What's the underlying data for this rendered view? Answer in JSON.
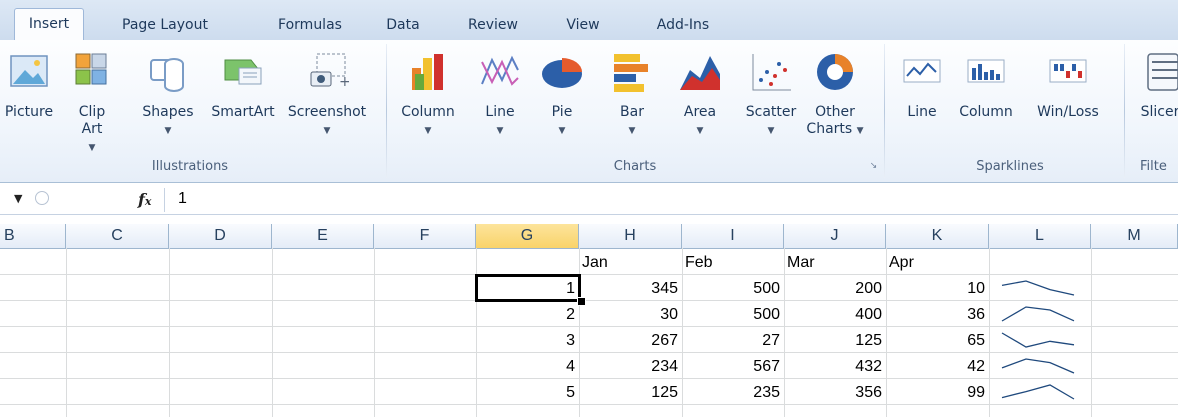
{
  "tabs": [
    "Insert",
    "Page Layout",
    "Formulas",
    "Data",
    "Review",
    "View",
    "Add-Ins"
  ],
  "active_tab": "Insert",
  "ribbon": {
    "illustrations": {
      "label": "Illustrations",
      "buttons": [
        {
          "label": "Picture",
          "icon": "picture-icon"
        },
        {
          "label": "Clip\nArt",
          "icon": "clip-art-icon"
        },
        {
          "label": "Shapes",
          "icon": "shapes-icon"
        },
        {
          "label": "SmartArt",
          "icon": "smartart-icon"
        },
        {
          "label": "Screenshot",
          "icon": "screenshot-icon"
        }
      ]
    },
    "charts": {
      "label": "Charts",
      "buttons": [
        {
          "label": "Column",
          "icon": "column-chart-icon"
        },
        {
          "label": "Line",
          "icon": "line-chart-icon"
        },
        {
          "label": "Pie",
          "icon": "pie-chart-icon"
        },
        {
          "label": "Bar",
          "icon": "bar-chart-icon"
        },
        {
          "label": "Area",
          "icon": "area-chart-icon"
        },
        {
          "label": "Scatter",
          "icon": "scatter-chart-icon"
        },
        {
          "label": "Other\nCharts",
          "icon": "other-charts-icon"
        }
      ]
    },
    "sparklines": {
      "label": "Sparklines",
      "buttons": [
        {
          "label": "Line",
          "icon": "sparkline-line-icon"
        },
        {
          "label": "Column",
          "icon": "sparkline-column-icon"
        },
        {
          "label": "Win/Loss",
          "icon": "sparkline-winloss-icon"
        }
      ]
    },
    "filter": {
      "label": "Filte",
      "buttons": [
        {
          "label": "Slicer",
          "icon": "slicer-icon"
        }
      ]
    }
  },
  "formula_bar": {
    "fx": "fx",
    "value": "1"
  },
  "columns": [
    "B",
    "C",
    "D",
    "E",
    "F",
    "G",
    "H",
    "I",
    "J",
    "K",
    "L",
    "M"
  ],
  "selected_column": "G",
  "sheet": {
    "header_row": [
      "Jan",
      "Feb",
      "Mar",
      "Apr"
    ],
    "rows": [
      {
        "g": "1",
        "values": [
          "345",
          "500",
          "200",
          "10"
        ]
      },
      {
        "g": "2",
        "values": [
          "30",
          "500",
          "400",
          "36"
        ]
      },
      {
        "g": "3",
        "values": [
          "267",
          "27",
          "125",
          "65"
        ]
      },
      {
        "g": "4",
        "values": [
          "234",
          "567",
          "432",
          "42"
        ]
      },
      {
        "g": "5",
        "values": [
          "125",
          "235",
          "356",
          "99"
        ]
      }
    ]
  },
  "colors": {
    "accent": "#f9d36a",
    "tab_text": "#1e395b",
    "sparkline": "#1f497d"
  }
}
